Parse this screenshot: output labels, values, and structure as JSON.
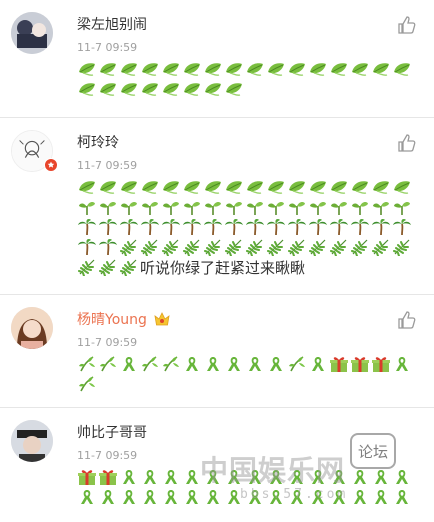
{
  "comments": [
    {
      "user": "梁左旭别闹",
      "time": "11-7 09:59",
      "emoji_rows": [
        {
          "icon": "leaf-icon",
          "count": 16
        },
        {
          "icon": "leaf-icon",
          "count": 8
        }
      ]
    },
    {
      "user": "柯玲玲",
      "time": "11-7 09:59",
      "verified": true,
      "emoji_rows": [
        {
          "icon": "leaf-icon",
          "count": 16
        },
        {
          "icon": "sprout-icon",
          "count": 16
        },
        {
          "icon": "palm-tree-icon",
          "count": 16
        },
        {
          "icon": "palm-tree-icon",
          "count": 2,
          "then": {
            "icon": "fern-icon",
            "count": 14
          }
        }
      ],
      "trail_icon": "fern-icon",
      "trail_count": 3,
      "text": "听说你绿了赶紧过来瞅瞅"
    },
    {
      "user": "杨晴Young",
      "time": "11-7 09:59",
      "badge_icon": "crown-icon",
      "emoji_sequence": [
        "bamboo-icon",
        "bamboo-icon",
        "ribbon-icon",
        "bamboo-icon",
        "bamboo-icon",
        "ribbon-icon",
        "ribbon-icon",
        "ribbon-icon",
        "ribbon-icon",
        "ribbon-icon",
        "bamboo-icon",
        "ribbon-icon",
        "gift-icon",
        "gift-icon",
        "gift-icon",
        "ribbon-icon",
        "bamboo-icon"
      ]
    },
    {
      "user": "帅比子哥哥",
      "time": "11-7 09:59",
      "emoji_sequence": [
        "gift-icon",
        "gift-icon",
        "ribbon-icon",
        "ribbon-icon",
        "ribbon-icon",
        "ribbon-icon",
        "ribbon-icon",
        "ribbon-icon",
        "ribbon-icon",
        "ribbon-icon",
        "ribbon-icon",
        "ribbon-icon",
        "ribbon-icon",
        "ribbon-icon",
        "ribbon-icon",
        "ribbon-icon",
        "ribbon-icon",
        "ribbon-icon",
        "ribbon-icon",
        "ribbon-icon",
        "ribbon-icon",
        "ribbon-icon",
        "ribbon-icon",
        "ribbon-icon",
        "ribbon-icon",
        "ribbon-icon",
        "ribbon-icon",
        "ribbon-icon",
        "ribbon-icon",
        "ribbon-icon",
        "ribbon-icon",
        "ribbon-icon"
      ]
    }
  ],
  "watermark": {
    "main": "中国娱乐网",
    "bubble": "论坛",
    "sub": "bbs.57.com"
  },
  "colors": {
    "name_highlight": "#eb7350",
    "time": "#a0a0a0",
    "leaf_green": "#6fb83a",
    "gift_red": "#d93b2b",
    "gift_green": "#8bc34a"
  }
}
